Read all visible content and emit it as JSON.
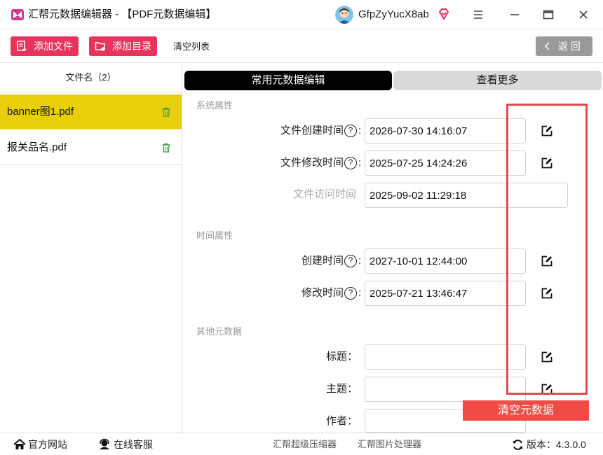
{
  "app": {
    "title": "汇帮元数据编辑器 - 【PDF元数据编辑】",
    "username": "GfpZyYucX8ab"
  },
  "toolbar": {
    "add_file": "添加文件",
    "add_folder": "添加目录",
    "clear_list": "清空列表",
    "back": "返 回"
  },
  "sidebar": {
    "header": "文件名（2）",
    "files": [
      {
        "name": "banner图1.pdf",
        "selected": true
      },
      {
        "name": "报关品名.pdf",
        "selected": false
      }
    ]
  },
  "tabs": [
    {
      "label": "常用元数据编辑",
      "active": true
    },
    {
      "label": "查看更多",
      "active": false
    }
  ],
  "sections": {
    "system": "系统属性",
    "time": "时间属性",
    "other": "其他元数据"
  },
  "fields": {
    "file_created": {
      "label": "文件创建时间",
      "value": "2026-07-30 14:16:07"
    },
    "file_modified": {
      "label": "文件修改时间",
      "value": "2025-07-25 14:24:26"
    },
    "file_accessed": {
      "label": "文件访问时间",
      "value": "2025-09-02 11:29:18"
    },
    "created": {
      "label": "创建时间",
      "value": "2027-10-01 12:44:00"
    },
    "modified": {
      "label": "修改时间",
      "value": "2025-07-21 13:46:47"
    },
    "title": {
      "label": "标题：",
      "value": ""
    },
    "subject": {
      "label": "主题：",
      "value": ""
    },
    "author": {
      "label": "作者：",
      "value": ""
    }
  },
  "clear_metadata": "清空元数据",
  "status": {
    "website": "官方网站",
    "support": "在线客服",
    "compressor": "汇帮超级压缩器",
    "image_tool": "汇帮图片处理器",
    "version_label": "版本：",
    "version": "4.3.0.0"
  },
  "colors": {
    "accent": "#e8335a",
    "selected_row": "#e9cf0a",
    "active_tab": "#000000",
    "inactive_tab": "#d9d9d9",
    "highlight_box": "#e34a4f",
    "clear_button": "#f24a44",
    "trash_icon": "#3fa63f"
  }
}
